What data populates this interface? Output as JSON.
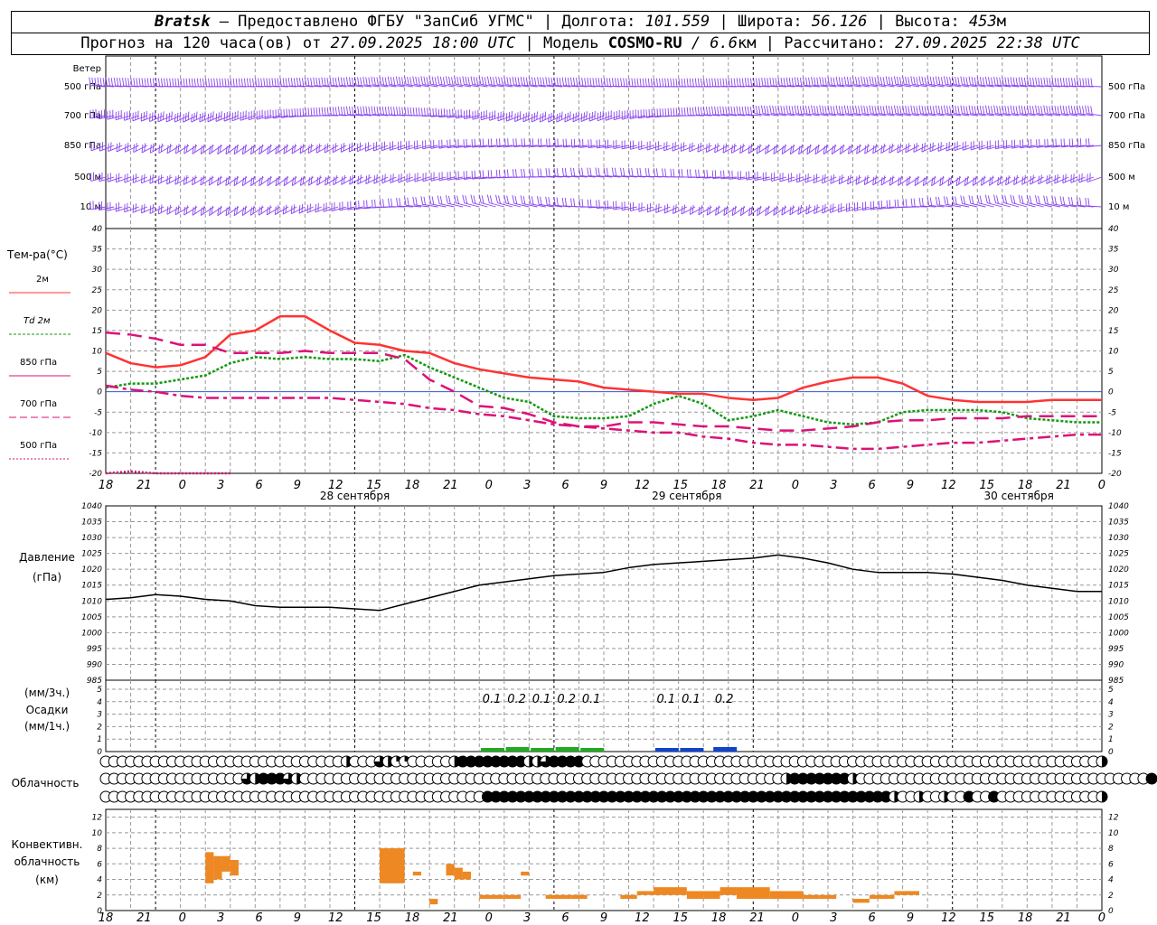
{
  "header": {
    "station": "Bratsk",
    "provider": "– Предоставлено ФГБУ \"ЗапСиб УГМС\"",
    "lon_label": "Долгота:",
    "lon": "101.559",
    "lat_label": "Широта:",
    "lat": "56.126",
    "alt_label": "Высота:",
    "alt": "453",
    "alt_unit": "м",
    "forecast_prefix": "Прогноз на 120 часа(ов) от",
    "forecast_time": "27.09.2025 18:00 UTC",
    "model_label": "Модель",
    "model": "COSMO-RU",
    "resolution": "/ 6.6",
    "res_unit": "км",
    "calc_label": "Рассчитано:",
    "calc_time": "27.09.2025 22:38 UTC"
  },
  "labels": {
    "wind": "Ветер",
    "wind_levels": [
      "500 гПа",
      "700 гПа",
      "850 гПа",
      "500 м",
      "10  м"
    ],
    "temp_title": "Тем-ра(°C)",
    "temp_legend": [
      {
        "text": "2м",
        "color": "#ff3333",
        "dash": ""
      },
      {
        "text": "Td  2м",
        "color": "#119911",
        "dash": "3,2"
      },
      {
        "text": "850 гПа",
        "color": "#dd1177",
        "dash": ""
      },
      {
        "text": "700 гПа",
        "color": "#dd1177",
        "dash": "8,4"
      },
      {
        "text": "500 гПа",
        "color": "#dd1177",
        "dash": "2,2"
      }
    ],
    "pressure": [
      "Давление",
      "(гПа)"
    ],
    "precip": [
      "(мм/3ч.)",
      "Осадки",
      "(мм/1ч.)"
    ],
    "cloud": "Облачность",
    "conv": [
      "Конвективн.",
      "облачность",
      "(км)"
    ]
  },
  "x_axis": {
    "hour_labels": [
      "18",
      "21",
      "0",
      "3",
      "6",
      "9",
      "12",
      "15",
      "18",
      "21",
      "0",
      "3",
      "6",
      "9",
      "12",
      "15",
      "18",
      "21",
      "0",
      "3",
      "6",
      "9",
      "12",
      "15",
      "18",
      "21",
      "0"
    ],
    "dates": [
      "28 сентября",
      "29 сентября",
      "30 сентября"
    ]
  },
  "chart_data": [
    {
      "type": "line",
      "title": "Тем-ра(°C)",
      "x_unit": "hours since 27.09.2025 18:00 UTC",
      "ylim": [
        -20,
        40
      ],
      "grid": true,
      "series": [
        {
          "name": "2м",
          "color": "#ff3333",
          "x": [
            0,
            3,
            6,
            9,
            12,
            15,
            18,
            21,
            24,
            27,
            30,
            33,
            36,
            39,
            42,
            45,
            48,
            51,
            54,
            57,
            60,
            63,
            66,
            69,
            72,
            75,
            78,
            81,
            84,
            87,
            90,
            93,
            96,
            99,
            102,
            105,
            108,
            111,
            114,
            117,
            120
          ],
          "values": [
            9.5,
            7,
            6,
            6.5,
            8.5,
            14,
            15,
            18.5,
            18.5,
            15,
            12,
            11.5,
            10,
            9.5,
            7,
            5.5,
            4.5,
            3.5,
            3,
            2.5,
            1,
            0.5,
            0,
            -0.5,
            -0.5,
            -1.5,
            -2,
            -1.5,
            1,
            2.5,
            3.5,
            3.5,
            2,
            -1,
            -2,
            -2.5,
            -2.5,
            -2.5,
            -2,
            -2,
            -2
          ]
        },
        {
          "name": "Td  2м",
          "color": "#119911",
          "x": [
            0,
            3,
            6,
            9,
            12,
            15,
            18,
            21,
            24,
            27,
            30,
            33,
            36,
            39,
            42,
            45,
            48,
            51,
            54,
            57,
            60,
            63,
            66,
            69,
            72,
            75,
            78,
            81,
            84,
            87,
            90,
            93,
            96,
            99,
            102,
            105,
            108,
            111,
            114,
            117,
            120
          ],
          "values": [
            1,
            2,
            2,
            3,
            4,
            7,
            8.5,
            8,
            8.5,
            8,
            8,
            7.5,
            9,
            6,
            3.5,
            1,
            -1.5,
            -2.5,
            -6,
            -6.5,
            -6.5,
            -6,
            -3,
            -1,
            -3,
            -7,
            -6,
            -4.5,
            -6,
            -7.5,
            -8,
            -7.5,
            -5,
            -4.5,
            -4.5,
            -4.5,
            -5,
            -6.5,
            -7,
            -7.5,
            -7.5
          ]
        },
        {
          "name": "850 гПа",
          "color": "#dd1177",
          "x": [
            0,
            3,
            6,
            9,
            12,
            15,
            18,
            21,
            24,
            27,
            30,
            33,
            36,
            39,
            42,
            45,
            48,
            51,
            54,
            57,
            60,
            63,
            66,
            69,
            72,
            75,
            78,
            81,
            84,
            87,
            90,
            93,
            96,
            99,
            102,
            105,
            108,
            111,
            114,
            117,
            120
          ],
          "values": [
            14.5,
            14,
            13,
            11.5,
            11.5,
            9.5,
            9.5,
            9.5,
            10,
            9.5,
            9.5,
            9.5,
            8,
            3,
            0,
            -3.5,
            -4,
            -5.5,
            -7.5,
            -8.5,
            -8.5,
            -7.5,
            -7.5,
            -8,
            -8.5,
            -8.5,
            -9,
            -9.5,
            -9.5,
            -9,
            -8.5,
            -7.5,
            -7,
            -7,
            -6.5,
            -6.5,
            -6.5,
            -6,
            -6,
            -6,
            -6
          ]
        },
        {
          "name": "700 гПа",
          "color": "#dd1177",
          "x": [
            0,
            3,
            6,
            9,
            12,
            15,
            18,
            21,
            24,
            27,
            30,
            33,
            36,
            39,
            42,
            45,
            48,
            51,
            54,
            57,
            60,
            63,
            66,
            69,
            72,
            75,
            78,
            81,
            84,
            87,
            90,
            93,
            96,
            99,
            102,
            105,
            108,
            111,
            114,
            117,
            120
          ],
          "values": [
            1.5,
            0.5,
            0,
            -1,
            -1.5,
            -1.5,
            -1.5,
            -1.5,
            -1.5,
            -1.5,
            -2,
            -2.5,
            -3,
            -4,
            -4.5,
            -5.5,
            -6,
            -7,
            -8,
            -8.5,
            -9,
            -9.5,
            -10,
            -10,
            -11,
            -11.5,
            -12.5,
            -13,
            -13,
            -13.5,
            -14,
            -14,
            -13.5,
            -13,
            -12.5,
            -12.5,
            -12,
            -11.5,
            -11,
            -10.5,
            -10.5
          ]
        },
        {
          "name": "500 гПа",
          "color": "#dd1177",
          "x": [
            0,
            3,
            6,
            9,
            12,
            15
          ],
          "values": [
            -20,
            -19.5,
            -20,
            -20,
            -20,
            -20
          ]
        }
      ]
    },
    {
      "type": "line",
      "title": "Давление (гПа)",
      "x_unit": "hours since 27.09.2025 18:00 UTC",
      "ylim": [
        985,
        1040
      ],
      "grid": true,
      "series": [
        {
          "name": "Давление",
          "color": "#000000",
          "x": [
            0,
            3,
            6,
            9,
            12,
            15,
            18,
            21,
            24,
            27,
            30,
            33,
            36,
            39,
            42,
            45,
            48,
            51,
            54,
            57,
            60,
            63,
            66,
            69,
            72,
            75,
            78,
            81,
            84,
            87,
            90,
            93,
            96,
            99,
            102,
            105,
            108,
            111,
            114,
            117,
            120
          ],
          "values": [
            1010.5,
            1011,
            1012,
            1011.5,
            1010.5,
            1010,
            1008.5,
            1008,
            1008,
            1008,
            1007.5,
            1007,
            1009,
            1011,
            1013,
            1015,
            1016,
            1017,
            1018,
            1018.5,
            1019,
            1020.5,
            1021.5,
            1022,
            1022.5,
            1023,
            1023.5,
            1024.5,
            1023.5,
            1022,
            1020,
            1019,
            1019,
            1019,
            1018.5,
            1017.5,
            1016.5,
            1015,
            1014,
            1013,
            1013
          ]
        }
      ]
    },
    {
      "type": "bar",
      "title": "Осадки",
      "ylim": [
        0,
        5
      ],
      "annotations": [
        "0.1",
        "0.2",
        "0.1",
        "0.2",
        "0.1",
        "0.1",
        "0.1",
        "0.2"
      ],
      "series": [
        {
          "name": "Осадки",
          "x": [
            46.5,
            49.5,
            52.5,
            55.5,
            58.5,
            67.5,
            70.5,
            74.5
          ],
          "values": [
            0.1,
            0.2,
            0.1,
            0.2,
            0.1,
            0.1,
            0.1,
            0.2
          ],
          "colors": [
            "#22aa22",
            "#22aa22",
            "#22aa22",
            "#22aa22",
            "#22aa22",
            "#1144cc",
            "#1144cc",
            "#1144cc"
          ]
        }
      ]
    },
    {
      "type": "heatmap",
      "title": "Облачность",
      "levels": [
        "верхний",
        "средний",
        "нижний"
      ],
      "note": "0=0, 1=1/4, 2=1/2, 3=3/4, 4=8/8",
      "rows": [
        [
          0,
          0,
          0,
          0,
          0,
          0,
          0,
          0,
          0,
          0,
          0,
          0,
          0,
          0,
          0,
          0,
          0,
          0,
          0,
          0,
          0,
          0,
          0,
          0,
          0,
          0,
          0,
          0,
          0,
          2,
          0,
          0,
          0,
          3,
          2,
          1,
          1,
          0,
          0,
          0,
          0,
          0,
          2,
          4,
          4,
          4,
          4,
          4,
          4,
          4,
          4,
          2,
          2,
          3,
          4,
          4,
          4,
          4,
          0,
          0,
          0,
          0,
          0,
          0,
          0,
          0,
          0,
          0,
          0,
          0,
          0,
          0,
          0,
          0,
          0,
          0,
          0,
          0,
          0,
          0,
          0,
          0,
          0,
          0,
          0,
          0,
          0,
          0,
          0,
          0,
          0,
          0,
          0,
          0,
          0,
          0,
          0,
          0,
          0,
          0,
          0,
          0,
          0,
          0,
          0,
          0,
          0,
          0,
          0,
          0,
          0,
          0,
          0,
          0,
          0,
          0,
          0,
          0,
          0,
          0,
          2
        ],
        [
          0,
          0,
          0,
          0,
          0,
          0,
          0,
          0,
          0,
          0,
          0,
          0,
          0,
          0,
          0,
          0,
          0,
          3,
          2,
          4,
          4,
          4,
          3,
          2,
          0,
          0,
          0,
          0,
          0,
          0,
          0,
          0,
          0,
          0,
          0,
          0,
          0,
          0,
          0,
          0,
          0,
          0,
          0,
          0,
          0,
          0,
          0,
          0,
          0,
          0,
          0,
          0,
          0,
          0,
          0,
          0,
          0,
          0,
          0,
          0,
          0,
          0,
          0,
          0,
          0,
          0,
          0,
          0,
          0,
          0,
          0,
          0,
          0,
          0,
          0,
          0,
          0,
          0,
          0,
          0,
          0,
          0,
          2,
          4,
          4,
          4,
          4,
          4,
          4,
          4,
          2,
          0,
          0,
          0,
          0,
          0,
          0,
          0,
          0,
          0,
          0,
          0,
          0,
          0,
          0,
          0,
          0,
          0,
          0,
          0,
          0,
          0,
          0,
          0,
          0,
          0,
          0,
          0,
          0,
          0,
          0,
          0,
          0,
          0,
          0,
          0,
          4
        ],
        [
          0,
          0,
          0,
          0,
          0,
          0,
          0,
          0,
          0,
          0,
          0,
          0,
          0,
          0,
          0,
          0,
          0,
          0,
          0,
          0,
          0,
          0,
          0,
          0,
          0,
          0,
          0,
          0,
          0,
          0,
          0,
          0,
          0,
          0,
          0,
          0,
          0,
          0,
          0,
          0,
          0,
          0,
          0,
          0,
          0,
          0,
          0,
          0,
          0,
          0,
          0,
          0,
          0,
          0,
          0,
          0,
          0,
          0,
          0,
          0,
          0,
          0,
          0,
          0,
          0,
          0,
          0,
          0,
          0,
          0,
          0,
          0,
          0,
          0,
          0,
          0,
          0,
          0,
          0,
          0,
          0,
          0,
          0,
          0,
          0,
          0,
          0,
          0,
          0,
          0,
          0,
          0,
          0,
          0,
          0,
          0,
          0,
          0,
          0,
          0,
          0,
          0,
          0,
          0,
          0,
          0,
          0,
          0,
          0,
          0,
          0,
          0,
          0,
          0,
          0,
          0,
          0,
          0,
          0,
          0,
          0
        ]
      ]
    },
    {
      "type": "bar",
      "title": "Конвективн. облачность (км)",
      "ylim": [
        0,
        13
      ],
      "series": [
        {
          "name": "Конвективн. облачность",
          "color": "#ee8822",
          "bars": [
            [
              12,
              13,
              3.5,
              7.5
            ],
            [
              13,
              14,
              4,
              7
            ],
            [
              14,
              15,
              5,
              7
            ],
            [
              15,
              16,
              4.5,
              6.5
            ],
            [
              33,
              36,
              3.5,
              8
            ],
            [
              37,
              38,
              4.5,
              5
            ],
            [
              39,
              40,
              0.8,
              1.5
            ],
            [
              41,
              42,
              4.5,
              6
            ],
            [
              42,
              43,
              4,
              5.5
            ],
            [
              43,
              44,
              4,
              5
            ],
            [
              45,
              48,
              1.5,
              2
            ],
            [
              48,
              50,
              1.5,
              2
            ],
            [
              50,
              51,
              4.5,
              5
            ],
            [
              53,
              56,
              1.5,
              2
            ],
            [
              56,
              58,
              1.5,
              2
            ],
            [
              62,
              64,
              1.5,
              2
            ],
            [
              64,
              66,
              2,
              2.5
            ],
            [
              66,
              70,
              2,
              3
            ],
            [
              70,
              72,
              1.5,
              2.5
            ],
            [
              72,
              74,
              1.5,
              2.5
            ],
            [
              74,
              76,
              2,
              3
            ],
            [
              76,
              80,
              1.5,
              3
            ],
            [
              80,
              82,
              1.5,
              2.5
            ],
            [
              82,
              84,
              1.5,
              2.5
            ],
            [
              84,
              86,
              1.5,
              2
            ],
            [
              86,
              88,
              1.5,
              2
            ],
            [
              90,
              92,
              1,
              1.5
            ],
            [
              92,
              95,
              1.5,
              2
            ],
            [
              95,
              98,
              2,
              2.5
            ]
          ]
        }
      ]
    }
  ],
  "wind_glyph_color": "#8844ee"
}
